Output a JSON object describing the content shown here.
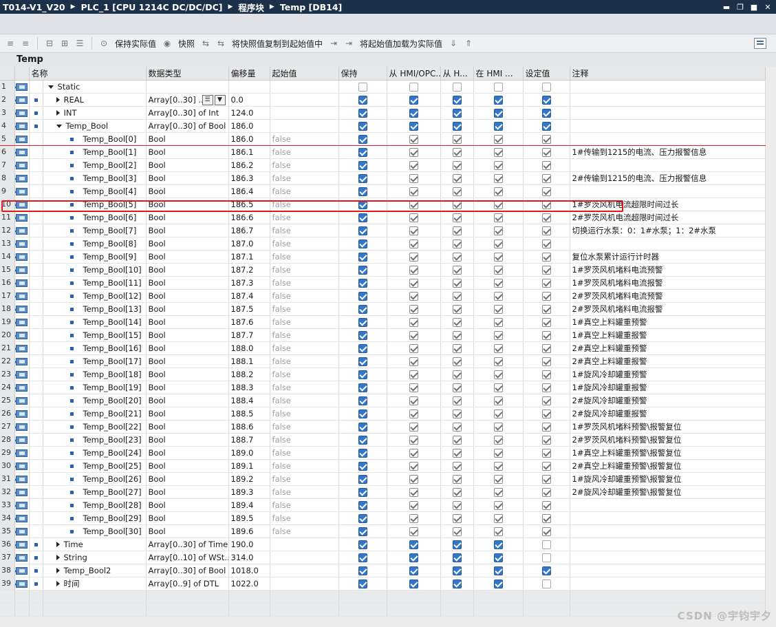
{
  "titlebar": {
    "crumbs": [
      "T014-V1_V20",
      "PLC_1 [CPU 1214C DC/DC/DC]",
      "程序块",
      "Temp [DB14]"
    ],
    "separator": "▶"
  },
  "toolbar": {
    "keep_actual": "保持实际值",
    "snapshot": "快照",
    "copy_snapshot": "将快照值复制到起始值中",
    "load_start": "将起始值加载为实际值"
  },
  "block": {
    "name": "Temp"
  },
  "columns": {
    "name": "名称",
    "datatype": "数据类型",
    "offset": "偏移量",
    "start": "起始值",
    "retain": "保持",
    "hmi_opc": "从 HMI/OPC...",
    "from_h": "从 H...",
    "in_hmi": "在 HMI ...",
    "setpoint": "设定值",
    "comment": "注释"
  },
  "rows": [
    {
      "n": "1",
      "name": "Static",
      "type": "",
      "offset": "",
      "start": "",
      "level": 0,
      "exp": "down",
      "sq": false,
      "dim": false,
      "chk": [
        "off",
        "off",
        "off",
        "off",
        "off"
      ],
      "comment": ""
    },
    {
      "n": "2",
      "name": "REAL",
      "type": "Array[0..30] ...",
      "offset": "0.0",
      "start": "",
      "level": 1,
      "exp": "right",
      "sq": true,
      "dim": false,
      "edit": true,
      "chk": [
        "on",
        "on",
        "on",
        "on",
        "on"
      ],
      "comment": ""
    },
    {
      "n": "3",
      "name": "INT",
      "type": "Array[0..30] of Int",
      "offset": "124.0",
      "start": "",
      "level": 1,
      "exp": "right",
      "sq": true,
      "dim": false,
      "chk": [
        "on",
        "on",
        "on",
        "on",
        "on"
      ],
      "comment": ""
    },
    {
      "n": "4",
      "name": "Temp_Bool",
      "type": "Array[0..30] of Bool",
      "offset": "186.0",
      "start": "",
      "level": 1,
      "exp": "down",
      "sq": true,
      "dim": false,
      "chk": [
        "on",
        "on",
        "on",
        "on",
        "on"
      ],
      "comment": ""
    },
    {
      "n": "5",
      "name": "Temp_Bool[0]",
      "type": "Bool",
      "offset": "186.0",
      "start": "false",
      "level": 2,
      "exp": "",
      "sq": true,
      "dim": true,
      "sel": true,
      "chk": [
        "on",
        "gr",
        "gr",
        "gr",
        "gr"
      ],
      "comment": ""
    },
    {
      "n": "6",
      "name": "Temp_Bool[1]",
      "type": "Bool",
      "offset": "186.1",
      "start": "false",
      "level": 2,
      "exp": "",
      "sq": true,
      "dim": true,
      "chk": [
        "on",
        "gr",
        "gr",
        "gr",
        "gr"
      ],
      "comment": "1#传输到1215的电流、压力报警信息"
    },
    {
      "n": "7",
      "name": "Temp_Bool[2]",
      "type": "Bool",
      "offset": "186.2",
      "start": "false",
      "level": 2,
      "exp": "",
      "sq": true,
      "dim": true,
      "chk": [
        "on",
        "gr",
        "gr",
        "gr",
        "gr"
      ],
      "comment": ""
    },
    {
      "n": "8",
      "name": "Temp_Bool[3]",
      "type": "Bool",
      "offset": "186.3",
      "start": "false",
      "level": 2,
      "exp": "",
      "sq": true,
      "dim": true,
      "chk": [
        "on",
        "gr",
        "gr",
        "gr",
        "gr"
      ],
      "comment": "2#传输到1215的电流、压力报警信息"
    },
    {
      "n": "9",
      "name": "Temp_Bool[4]",
      "type": "Bool",
      "offset": "186.4",
      "start": "false",
      "level": 2,
      "exp": "",
      "sq": true,
      "dim": true,
      "chk": [
        "on",
        "gr",
        "gr",
        "gr",
        "gr"
      ],
      "comment": ""
    },
    {
      "n": "10",
      "name": "Temp_Bool[5]",
      "type": "Bool",
      "offset": "186.5",
      "start": "false",
      "level": 2,
      "exp": "",
      "sq": true,
      "dim": true,
      "chk": [
        "on",
        "gr",
        "gr",
        "gr",
        "gr"
      ],
      "comment": "1#罗茨风机电流超限时间过长"
    },
    {
      "n": "11",
      "name": "Temp_Bool[6]",
      "type": "Bool",
      "offset": "186.6",
      "start": "false",
      "level": 2,
      "exp": "",
      "sq": true,
      "dim": true,
      "chk": [
        "on",
        "gr",
        "gr",
        "gr",
        "gr"
      ],
      "comment": "2#罗茨风机电流超限时间过长"
    },
    {
      "n": "12",
      "name": "Temp_Bool[7]",
      "type": "Bool",
      "offset": "186.7",
      "start": "false",
      "level": 2,
      "exp": "",
      "sq": true,
      "dim": true,
      "chk": [
        "on",
        "gr",
        "gr",
        "gr",
        "gr"
      ],
      "comment": "切换运行水泵：0：1#水泵；1：2#水泵"
    },
    {
      "n": "13",
      "name": "Temp_Bool[8]",
      "type": "Bool",
      "offset": "187.0",
      "start": "false",
      "level": 2,
      "exp": "",
      "sq": true,
      "dim": true,
      "chk": [
        "on",
        "gr",
        "gr",
        "gr",
        "gr"
      ],
      "comment": ""
    },
    {
      "n": "14",
      "name": "Temp_Bool[9]",
      "type": "Bool",
      "offset": "187.1",
      "start": "false",
      "level": 2,
      "exp": "",
      "sq": true,
      "dim": true,
      "chk": [
        "on",
        "gr",
        "gr",
        "gr",
        "gr"
      ],
      "comment": "复位水泵累计运行计时器"
    },
    {
      "n": "15",
      "name": "Temp_Bool[10]",
      "type": "Bool",
      "offset": "187.2",
      "start": "false",
      "level": 2,
      "exp": "",
      "sq": true,
      "dim": true,
      "chk": [
        "on",
        "gr",
        "gr",
        "gr",
        "gr"
      ],
      "comment": "1#罗茨风机堵料电流预警"
    },
    {
      "n": "16",
      "name": "Temp_Bool[11]",
      "type": "Bool",
      "offset": "187.3",
      "start": "false",
      "level": 2,
      "exp": "",
      "sq": true,
      "dim": true,
      "chk": [
        "on",
        "gr",
        "gr",
        "gr",
        "gr"
      ],
      "comment": "1#罗茨风机堵料电流报警"
    },
    {
      "n": "17",
      "name": "Temp_Bool[12]",
      "type": "Bool",
      "offset": "187.4",
      "start": "false",
      "level": 2,
      "exp": "",
      "sq": true,
      "dim": true,
      "chk": [
        "on",
        "gr",
        "gr",
        "gr",
        "gr"
      ],
      "comment": "2#罗茨风机堵料电流预警"
    },
    {
      "n": "18",
      "name": "Temp_Bool[13]",
      "type": "Bool",
      "offset": "187.5",
      "start": "false",
      "level": 2,
      "exp": "",
      "sq": true,
      "dim": true,
      "chk": [
        "on",
        "gr",
        "gr",
        "gr",
        "gr"
      ],
      "comment": "2#罗茨风机堵料电流报警"
    },
    {
      "n": "19",
      "name": "Temp_Bool[14]",
      "type": "Bool",
      "offset": "187.6",
      "start": "false",
      "level": 2,
      "exp": "",
      "sq": true,
      "dim": true,
      "chk": [
        "on",
        "gr",
        "gr",
        "gr",
        "gr"
      ],
      "comment": "1#真空上料罐重预警"
    },
    {
      "n": "20",
      "name": "Temp_Bool[15]",
      "type": "Bool",
      "offset": "187.7",
      "start": "false",
      "level": 2,
      "exp": "",
      "sq": true,
      "dim": true,
      "chk": [
        "on",
        "gr",
        "gr",
        "gr",
        "gr"
      ],
      "comment": "1#真空上料罐重报警"
    },
    {
      "n": "21",
      "name": "Temp_Bool[16]",
      "type": "Bool",
      "offset": "188.0",
      "start": "false",
      "level": 2,
      "exp": "",
      "sq": true,
      "dim": true,
      "chk": [
        "on",
        "gr",
        "gr",
        "gr",
        "gr"
      ],
      "comment": "2#真空上料罐重预警"
    },
    {
      "n": "22",
      "name": "Temp_Bool[17]",
      "type": "Bool",
      "offset": "188.1",
      "start": "false",
      "level": 2,
      "exp": "",
      "sq": true,
      "dim": true,
      "chk": [
        "on",
        "gr",
        "gr",
        "gr",
        "gr"
      ],
      "comment": "2#真空上料罐重报警"
    },
    {
      "n": "23",
      "name": "Temp_Bool[18]",
      "type": "Bool",
      "offset": "188.2",
      "start": "false",
      "level": 2,
      "exp": "",
      "sq": true,
      "dim": true,
      "chk": [
        "on",
        "gr",
        "gr",
        "gr",
        "gr"
      ],
      "comment": "1#旋风冷却罐重预警"
    },
    {
      "n": "24",
      "name": "Temp_Bool[19]",
      "type": "Bool",
      "offset": "188.3",
      "start": "false",
      "level": 2,
      "exp": "",
      "sq": true,
      "dim": true,
      "chk": [
        "on",
        "gr",
        "gr",
        "gr",
        "gr"
      ],
      "comment": "1#旋风冷却罐重报警"
    },
    {
      "n": "25",
      "name": "Temp_Bool[20]",
      "type": "Bool",
      "offset": "188.4",
      "start": "false",
      "level": 2,
      "exp": "",
      "sq": true,
      "dim": true,
      "chk": [
        "on",
        "gr",
        "gr",
        "gr",
        "gr"
      ],
      "comment": "2#旋风冷却罐重预警"
    },
    {
      "n": "26",
      "name": "Temp_Bool[21]",
      "type": "Bool",
      "offset": "188.5",
      "start": "false",
      "level": 2,
      "exp": "",
      "sq": true,
      "dim": true,
      "chk": [
        "on",
        "gr",
        "gr",
        "gr",
        "gr"
      ],
      "comment": "2#旋风冷却罐重报警"
    },
    {
      "n": "27",
      "name": "Temp_Bool[22]",
      "type": "Bool",
      "offset": "188.6",
      "start": "false",
      "level": 2,
      "exp": "",
      "sq": true,
      "dim": true,
      "chk": [
        "on",
        "gr",
        "gr",
        "gr",
        "gr"
      ],
      "comment": "1#罗茨风机堵料预警\\报警复位"
    },
    {
      "n": "28",
      "name": "Temp_Bool[23]",
      "type": "Bool",
      "offset": "188.7",
      "start": "false",
      "level": 2,
      "exp": "",
      "sq": true,
      "dim": true,
      "chk": [
        "on",
        "gr",
        "gr",
        "gr",
        "gr"
      ],
      "comment": "2#罗茨风机堵料预警\\报警复位"
    },
    {
      "n": "29",
      "name": "Temp_Bool[24]",
      "type": "Bool",
      "offset": "189.0",
      "start": "false",
      "level": 2,
      "exp": "",
      "sq": true,
      "dim": true,
      "chk": [
        "on",
        "gr",
        "gr",
        "gr",
        "gr"
      ],
      "comment": "1#真空上料罐重预警\\报警复位"
    },
    {
      "n": "30",
      "name": "Temp_Bool[25]",
      "type": "Bool",
      "offset": "189.1",
      "start": "false",
      "level": 2,
      "exp": "",
      "sq": true,
      "dim": true,
      "chk": [
        "on",
        "gr",
        "gr",
        "gr",
        "gr"
      ],
      "comment": "2#真空上料罐重预警\\报警复位"
    },
    {
      "n": "31",
      "name": "Temp_Bool[26]",
      "type": "Bool",
      "offset": "189.2",
      "start": "false",
      "level": 2,
      "exp": "",
      "sq": true,
      "dim": true,
      "chk": [
        "on",
        "gr",
        "gr",
        "gr",
        "gr"
      ],
      "comment": "1#旋风冷却罐重预警\\报警复位"
    },
    {
      "n": "32",
      "name": "Temp_Bool[27]",
      "type": "Bool",
      "offset": "189.3",
      "start": "false",
      "level": 2,
      "exp": "",
      "sq": true,
      "dim": true,
      "chk": [
        "on",
        "gr",
        "gr",
        "gr",
        "gr"
      ],
      "comment": "2#旋风冷却罐重预警\\报警复位"
    },
    {
      "n": "33",
      "name": "Temp_Bool[28]",
      "type": "Bool",
      "offset": "189.4",
      "start": "false",
      "level": 2,
      "exp": "",
      "sq": true,
      "dim": true,
      "chk": [
        "on",
        "gr",
        "gr",
        "gr",
        "gr"
      ],
      "comment": ""
    },
    {
      "n": "34",
      "name": "Temp_Bool[29]",
      "type": "Bool",
      "offset": "189.5",
      "start": "false",
      "level": 2,
      "exp": "",
      "sq": true,
      "dim": true,
      "chk": [
        "on",
        "gr",
        "gr",
        "gr",
        "gr"
      ],
      "comment": ""
    },
    {
      "n": "35",
      "name": "Temp_Bool[30]",
      "type": "Bool",
      "offset": "189.6",
      "start": "false",
      "level": 2,
      "exp": "",
      "sq": true,
      "dim": true,
      "chk": [
        "on",
        "gr",
        "gr",
        "gr",
        "gr"
      ],
      "comment": ""
    },
    {
      "n": "36",
      "name": "Time",
      "type": "Array[0..30] of Time",
      "offset": "190.0",
      "start": "",
      "level": 1,
      "exp": "right",
      "sq": true,
      "dim": false,
      "chk": [
        "on",
        "on",
        "on",
        "on",
        "off"
      ],
      "comment": ""
    },
    {
      "n": "37",
      "name": "String",
      "type": "Array[0..10] of WSt...",
      "offset": "314.0",
      "start": "",
      "level": 1,
      "exp": "right",
      "sq": true,
      "dim": false,
      "chk": [
        "on",
        "on",
        "on",
        "on",
        "off"
      ],
      "comment": ""
    },
    {
      "n": "38",
      "name": "Temp_Bool2",
      "type": "Array[0..30] of Bool",
      "offset": "1018.0",
      "start": "",
      "level": 1,
      "exp": "right",
      "sq": true,
      "dim": false,
      "chk": [
        "on",
        "on",
        "on",
        "on",
        "on"
      ],
      "comment": ""
    },
    {
      "n": "39",
      "name": "时间",
      "type": "Array[0..9] of DTL",
      "offset": "1022.0",
      "start": "",
      "level": 1,
      "exp": "right",
      "sq": true,
      "dim": false,
      "chk": [
        "on",
        "on",
        "on",
        "on",
        "off"
      ],
      "comment": ""
    }
  ],
  "watermark": "CSDN @宇钧宇夕",
  "colors": {
    "titlebar": "#1c3149",
    "checked": "#3476c8",
    "selection": "#e01818"
  }
}
